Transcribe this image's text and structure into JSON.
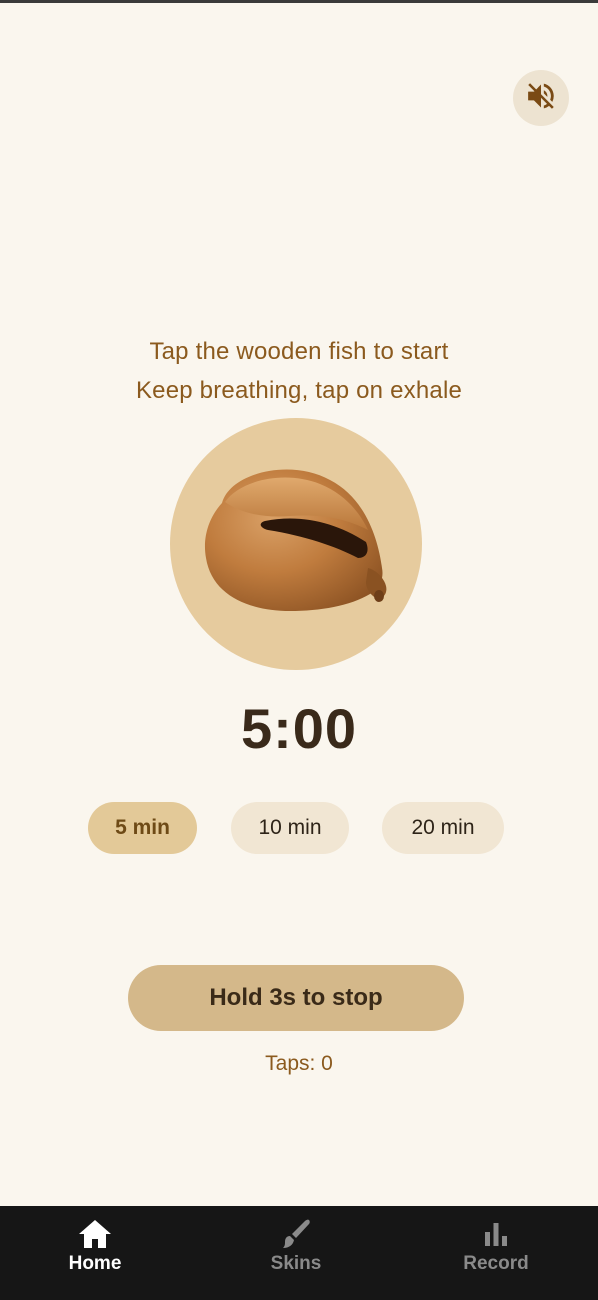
{
  "header": {
    "mute_icon": "speaker-muted-icon"
  },
  "instructions": {
    "line1": "Tap the wooden fish to start",
    "line2": "Keep breathing, tap on exhale"
  },
  "fish": {
    "icon": "wooden-fish-icon"
  },
  "timer": {
    "value": "5:00"
  },
  "durations": [
    {
      "label": "5 min",
      "selected": true
    },
    {
      "label": "10 min",
      "selected": false
    },
    {
      "label": "20 min",
      "selected": false
    }
  ],
  "stop_button": {
    "label": "Hold 3s to stop"
  },
  "taps": {
    "text": "Taps: 0"
  },
  "nav": {
    "items": [
      {
        "label": "Home",
        "icon": "home-icon",
        "active": true
      },
      {
        "label": "Skins",
        "icon": "brush-icon",
        "active": false
      },
      {
        "label": "Record",
        "icon": "bar-chart-icon",
        "active": false
      }
    ]
  },
  "colors": {
    "background": "#FAF6EE",
    "accent": "#8B5A1E",
    "selected_chip": "#E3C998",
    "stop_button": "#D4B88A",
    "nav_bar": "#161616"
  }
}
